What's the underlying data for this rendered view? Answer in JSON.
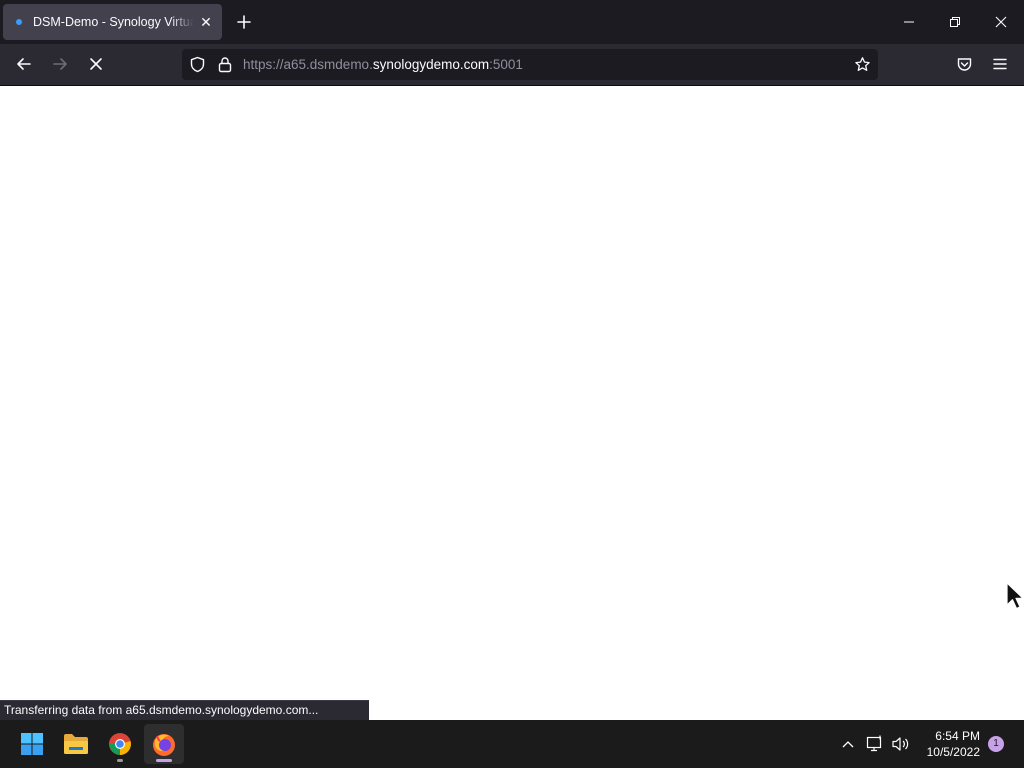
{
  "browser": {
    "tab": {
      "title": "DSM-Demo - Synology VirtualDSM",
      "close_icon": "close-icon",
      "favicon_color": "#3b9bff"
    },
    "address": {
      "prefix": "https://a65.dsmdemo.",
      "host": "synologydemo.com",
      "suffix": ":5001"
    },
    "status_text": "Transferring data from a65.dsmdemo.synologydemo.com..."
  },
  "taskbar": {
    "apps": [
      "start-icon",
      "file-explorer-icon",
      "chrome-icon",
      "firefox-icon"
    ],
    "clock": {
      "time": "6:54 PM",
      "date": "10/5/2022"
    },
    "notification_count": "1"
  },
  "colors": {
    "tabstrip": "#1c1b22",
    "navbar": "#2b2a33",
    "tab_active": "#42414d",
    "taskbar": "#1b1b1b"
  }
}
